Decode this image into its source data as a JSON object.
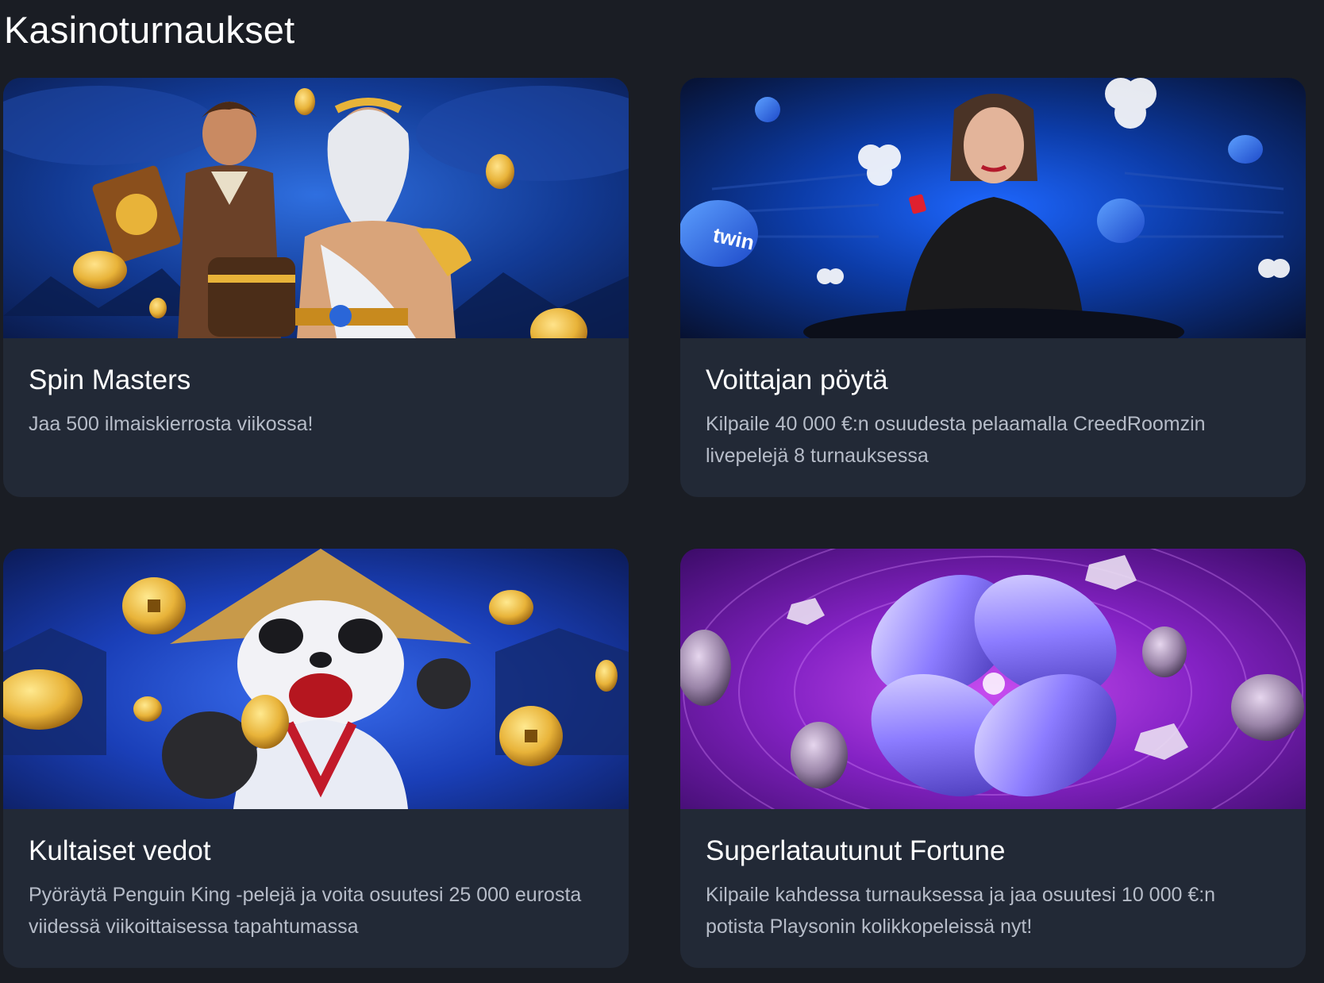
{
  "page": {
    "title": "Kasinoturnaukset"
  },
  "tournaments": [
    {
      "title": "Spin Masters",
      "description": "Jaa 500 ilmaiskierrosta viikossa!",
      "banner": "adventurer-and-zeus-gold-coins-banner"
    },
    {
      "title": "Voittajan pöytä",
      "description": "Kilpaile 40 000 €:n osuudesta pelaamalla CreedRoomzin livepelejä 8 turnauksessa",
      "banner": "live-dealer-poker-chips-banner",
      "chip_text": "twin"
    },
    {
      "title": "Kultaiset vedot",
      "description": "Pyöräytä Penguin King -pelejä ja voita osuutesi 25 000 eurosta viidessä viikoittaisessa tapahtumassa",
      "banner": "panda-warrior-gold-coins-banner"
    },
    {
      "title": "Superlatautunut Fortune",
      "description": "Kilpaile kahdessa turnauksessa ja jaa osuutesi 10 000 €:n potista Playsonin kolikkopeleissä nyt!",
      "banner": "crystal-clover-purple-banner"
    }
  ],
  "colors": {
    "background": "#1a1d24",
    "card": "#222936",
    "title_text": "#ffffff",
    "description_text": "#b6bcc8",
    "gold": "#e8b339",
    "blue": "#1a56d6",
    "purple": "#9b2fd0"
  }
}
